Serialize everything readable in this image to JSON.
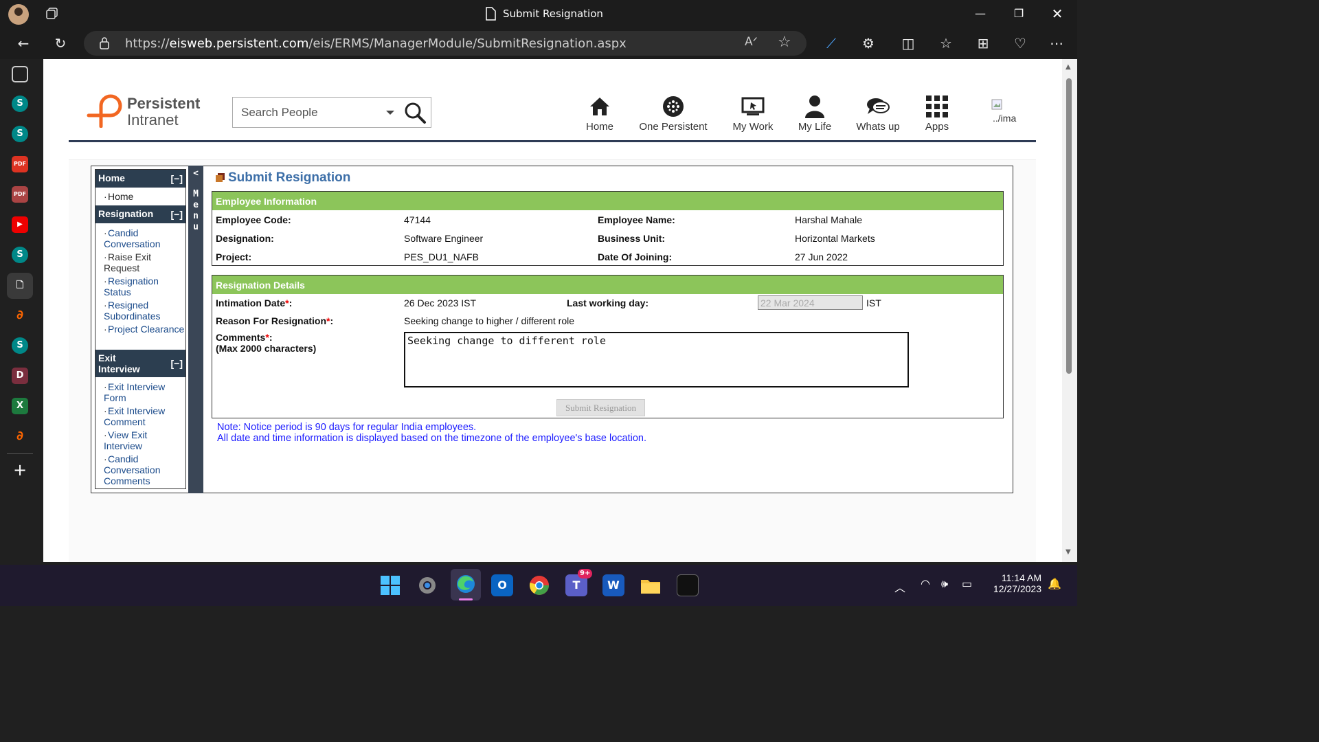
{
  "browser": {
    "tab_title": "Submit Resignation",
    "url_prefix": "https://",
    "url_domain": "eisweb.persistent.com",
    "url_path": "/eis/ERMS/ManagerModule/SubmitResignation.aspx"
  },
  "header": {
    "logo_line1": "Persistent",
    "logo_line2": "Intranet",
    "search_placeholder": "Search People",
    "nav": [
      {
        "label": "Home",
        "icon": "home-icon"
      },
      {
        "label": "One Persistent",
        "icon": "globe-icon"
      },
      {
        "label": "My Work",
        "icon": "monitor-icon"
      },
      {
        "label": "My Life",
        "icon": "person-icon"
      },
      {
        "label": "Whats up",
        "icon": "chat-icon"
      },
      {
        "label": "Apps",
        "icon": "grid-icon"
      }
    ],
    "broken_image_alt": "../ima"
  },
  "menu": {
    "sections": [
      {
        "title": "Home",
        "toggle": "[−]",
        "items": [
          "Home"
        ]
      },
      {
        "title": "Resignation",
        "toggle": "[−]",
        "items": [
          "Candid Conversation",
          "Raise Exit Request",
          "Resignation Status",
          "Resigned Subordinates",
          "Project Clearance"
        ]
      },
      {
        "title": "Exit Interview",
        "toggle": "[−]",
        "items": [
          "Exit Interview Form",
          "Exit Interview Comment",
          "View Exit Interview",
          "Candid Conversation Comments"
        ]
      }
    ],
    "collapse_label": "<",
    "strip_label": [
      "M",
      "e",
      "n",
      "u"
    ]
  },
  "page": {
    "title": "Submit Resignation",
    "employee_info": {
      "heading": "Employee Information",
      "code_label": "Employee Code:",
      "code": "47144",
      "name_label": "Employee Name:",
      "name": "Harshal Mahale",
      "designation_label": "Designation:",
      "designation": "Software Engineer",
      "bu_label": "Business Unit:",
      "bu": "Horizontal Markets",
      "project_label": "Project:",
      "project": "PES_DU1_NAFB",
      "doj_label": "Date Of Joining:",
      "doj": "27 Jun 2022"
    },
    "resignation": {
      "heading": "Resignation Details",
      "intimation_label": "Intimation Date",
      "intimation": "26 Dec 2023 IST",
      "lwd_label": "Last working day:",
      "lwd_value": "22 Mar 2024",
      "lwd_suffix": "IST",
      "reason_label": "Reason For Resignation",
      "reason": "Seeking change to higher / different role",
      "comments_label": "Comments",
      "comments_hint": "(Max 2000 characters)",
      "comments_value": "Seeking change to different role",
      "required_mark": "*",
      "colon": ":",
      "submit_label": "Submit Resignation"
    },
    "note_line1": "Note: Notice period is 90 days for regular India employees.",
    "note_line2": "All date and time information is displayed based on the timezone of the employee's base location."
  },
  "taskbar": {
    "time": "11:14 AM",
    "date": "12/27/2023",
    "teams_badge": "9+"
  },
  "colors": {
    "green_header": "#8cc55a",
    "menu_header": "#2c3e50",
    "link": "#1a4a8a",
    "page_title": "#3d6fa8",
    "note": "#1a1aff"
  }
}
